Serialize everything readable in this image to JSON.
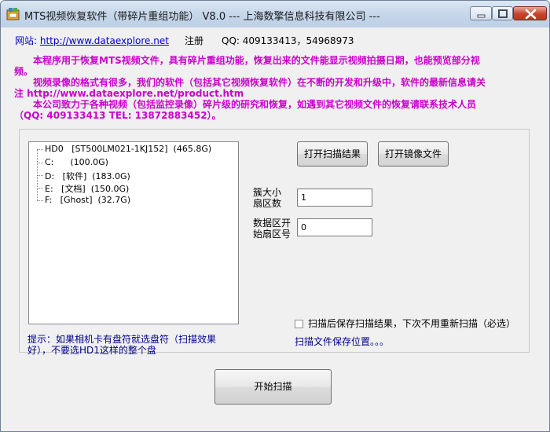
{
  "window": {
    "title": "MTS视频恢复软件（带碎片重组功能） V8.0 --- 上海数擎信息科技有限公司 ---",
    "controls": {
      "minimize": "minimize-icon",
      "maximize": "maximize-icon",
      "close": "close-icon"
    }
  },
  "links": {
    "site_label": "网站:",
    "site_url": "http://www.dataexplore.net",
    "register": "注册",
    "qq": "QQ:  409133413，54968973"
  },
  "intro": {
    "p1": "本程序用于恢复MTS视频文件，具有碎片重组功能，恢复出来的文件能显示视频拍摄日期，也能预览部分视频。",
    "p2": "视频录像的格式有很多，我们的软件（包括其它视频恢复软件）在不断的开发和升级中，软件的最新信息请关注 http://www.dataexplore.net/product.htm",
    "p3": "本公司致力于各种视频（包括监控录像）碎片级的研究和恢复，如遇到其它视频文件的恢复请联系技术人员（QQ: 409133413 TEL: 13872883452）。"
  },
  "tree": {
    "items": [
      "HD0   [ST500LM021-1KJ152]  (465.8G)",
      "C:      (100.0G)",
      "D:   [软件]  (183.0G)",
      "E:   [文档]  (150.0G)",
      "F:   [Ghost]  (32.7G)"
    ]
  },
  "buttons": {
    "open_scan": "打开扫描结果",
    "open_image": "打开镜像文件",
    "start": "开始扫描"
  },
  "fields": {
    "cluster_label": "簇大小\n扇区数",
    "cluster_value": "1",
    "start_label": "数据区开\n始扇区号",
    "start_value": "0"
  },
  "checkbox": {
    "label": "扫描后保存扫描结果，下次不用重新扫描（必选）",
    "checked": false
  },
  "hint": "提示：如果相机卡有盘符就选盘符（扫描效果好），不要选HD1这样的整个盘",
  "save_location": "扫描文件保存位置。。。",
  "colors": {
    "intro": "#cc00cc",
    "link": "#0000cc",
    "hint": "#00008b",
    "title_bar": "#c8d8eb",
    "close_button": "#c7432a"
  }
}
